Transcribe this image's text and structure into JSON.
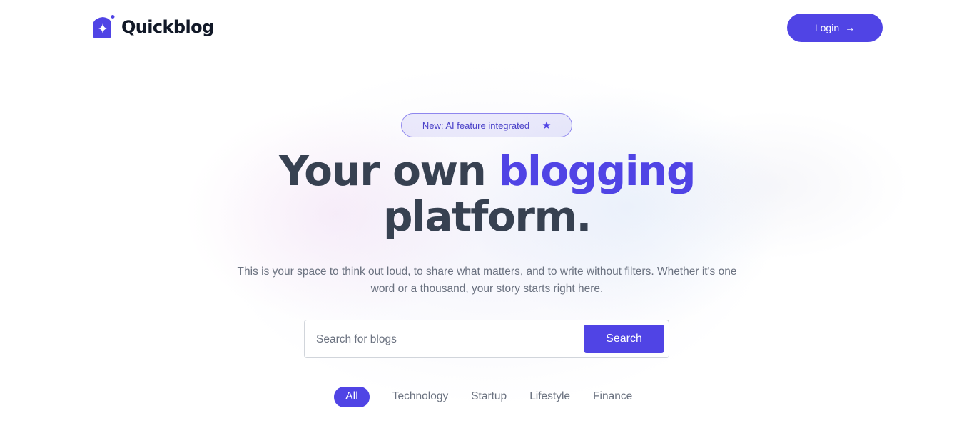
{
  "brand": {
    "name": "Quickblog",
    "logo_icon": "sparkle-bookmark-icon",
    "accent_color": "#5044e5"
  },
  "header": {
    "login_label": "Login",
    "login_icon": "arrow-right-icon"
  },
  "hero": {
    "badge_text": "New: AI feature integrated",
    "badge_icon": "star-icon",
    "title_part1": "Your own ",
    "title_highlight": "blogging",
    "title_part2": "platform.",
    "description": "This is your space to think out loud, to share what matters, and to write without filters. Whether it's one word or a thousand, your story starts right here."
  },
  "search": {
    "placeholder": "Search for blogs",
    "value": "",
    "button_label": "Search"
  },
  "categories": {
    "items": [
      {
        "label": "All",
        "active": true
      },
      {
        "label": "Technology",
        "active": false
      },
      {
        "label": "Startup",
        "active": false
      },
      {
        "label": "Lifestyle",
        "active": false
      },
      {
        "label": "Finance",
        "active": false
      }
    ]
  }
}
